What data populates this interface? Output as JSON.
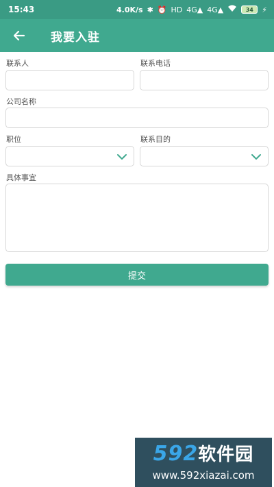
{
  "status_bar": {
    "time": "15:43",
    "network_speed": "4.0K/s",
    "bluetooth_icon": "bluetooth-icon",
    "alarm_icon": "alarm-icon",
    "hd_label": "HD",
    "signal_1": "4G",
    "signal_2": "4G",
    "wifi_icon": "wifi-icon",
    "battery": "34",
    "charging_icon": "charging-icon"
  },
  "appbar": {
    "back_icon": "arrow-left-icon",
    "title": "我要入驻"
  },
  "form": {
    "contact_label": "联系人",
    "contact_value": "",
    "phone_label": "联系电话",
    "phone_value": "",
    "company_label": "公司名称",
    "company_value": "",
    "position_label": "职位",
    "position_value": "",
    "purpose_label": "联系目的",
    "purpose_value": "",
    "details_label": "具体事宜",
    "details_value": "",
    "submit_label": "提交"
  },
  "watermark": {
    "number": "592",
    "cn_text": "软件园",
    "url": "www.592xiazai.com"
  },
  "colors": {
    "status_bar": "#3a9b84",
    "primary": "#40a98f",
    "border": "#d6d6d6"
  }
}
